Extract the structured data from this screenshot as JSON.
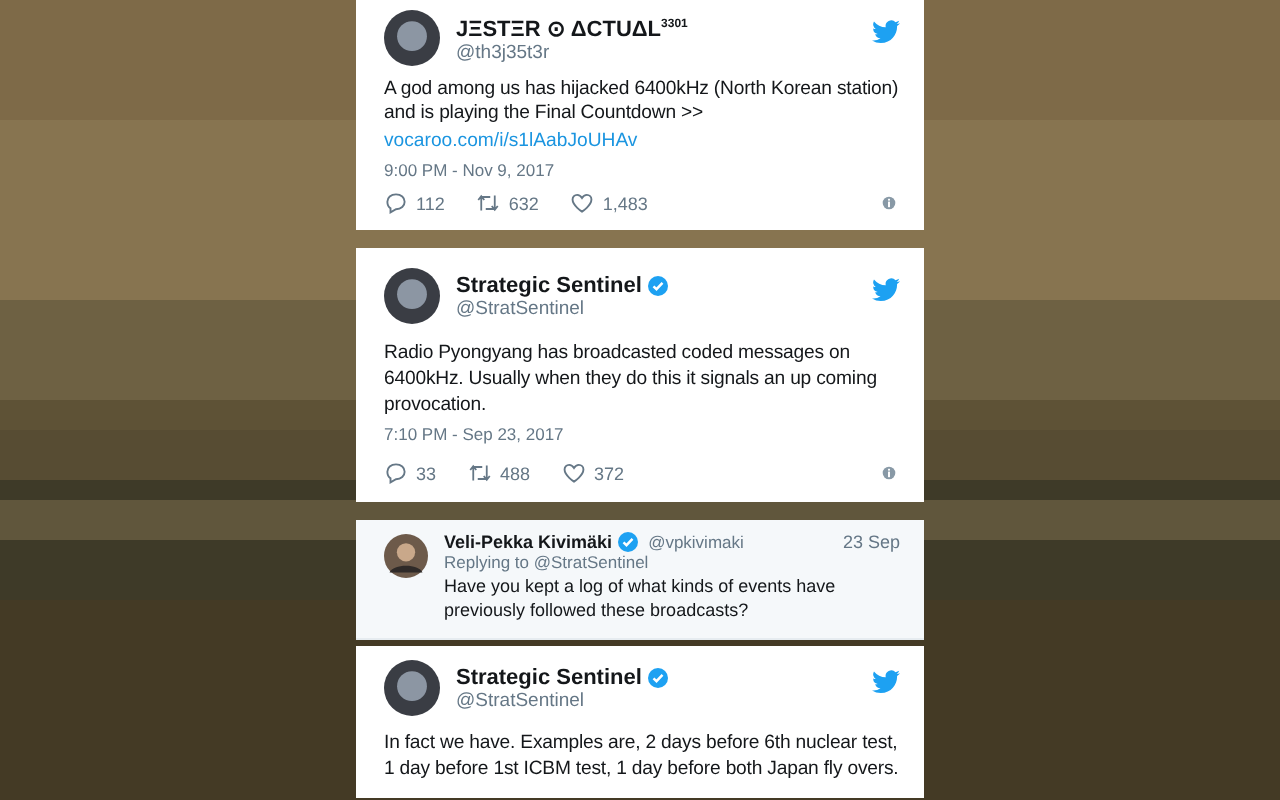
{
  "tweets": [
    {
      "kind": "tweet",
      "name": "JΞSTΞR ⊙ ΔCTUΔL$^{3301}$",
      "verified": false,
      "handle": "@th3j35t3r",
      "text": "A god among us has hijacked 6400kHz (North Korean station) and is playing the Final Countdown >>",
      "link": "vocaroo.com/i/s1lAabJoUHAv",
      "time": "9:00 PM - Nov 9, 2017",
      "replies": "112",
      "retweets": "632",
      "likes": "1,483"
    },
    {
      "kind": "tweet",
      "name": "Strategic Sentinel",
      "verified": true,
      "handle": "@StratSentinel",
      "text": "Radio Pyongyang has broadcasted coded messages on 6400kHz. Usually when they do this it signals an up coming provocation.",
      "time": "7:10 PM - Sep 23, 2017",
      "replies": "33",
      "retweets": "488",
      "likes": "372"
    },
    {
      "kind": "reply",
      "name": "Veli-Pekka Kivimäki",
      "verified": true,
      "handle": "@vpkivimaki",
      "date": "23 Sep",
      "replying_to": "Replying to @StratSentinel",
      "text": "Have you kept a log of what kinds of events have previously followed these broadcasts?"
    },
    {
      "kind": "tweet",
      "name": "Strategic Sentinel",
      "verified": true,
      "handle": "@StratSentinel",
      "text": "In fact we have. Examples are, 2 days before 6th nuclear test, 1 day before 1st ICBM test, 1 day before both Japan fly overs."
    }
  ]
}
